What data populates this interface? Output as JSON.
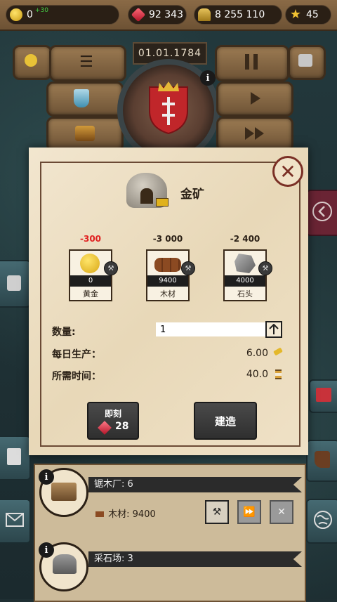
{
  "topbar": {
    "gold": "0",
    "gold_plus": "+30",
    "gems": "92 343",
    "population": "8 255 110",
    "stars": "45"
  },
  "header": {
    "date": "01.01.1784",
    "info": "i"
  },
  "modal": {
    "title": "金矿",
    "close": "✕",
    "costs": [
      {
        "cost": "-300",
        "value": "0",
        "label": "黄金",
        "cost_color": "#e02020"
      },
      {
        "cost": "-3 000",
        "value": "9400",
        "label": "木材",
        "cost_color": "#2a2016"
      },
      {
        "cost": "-2 400",
        "value": "4000",
        "label": "石头",
        "cost_color": "#2a2016"
      }
    ],
    "quantity_label": "数量:",
    "quantity_value": "1",
    "daily_label": "每日生产：",
    "daily_value": "6.00",
    "time_label": "所需时间：",
    "time_value": "40.0",
    "instant_label": "即刻",
    "instant_cost": "28",
    "build_label": "建造"
  },
  "list": {
    "items": [
      {
        "title": "锯木厂: 6",
        "resource": "木材: 9400"
      },
      {
        "title": "采石场: 3"
      }
    ]
  },
  "colors": {
    "parchment": "#efe1c6",
    "wood": "#8a6a46",
    "accent_red": "#7a2f25"
  }
}
